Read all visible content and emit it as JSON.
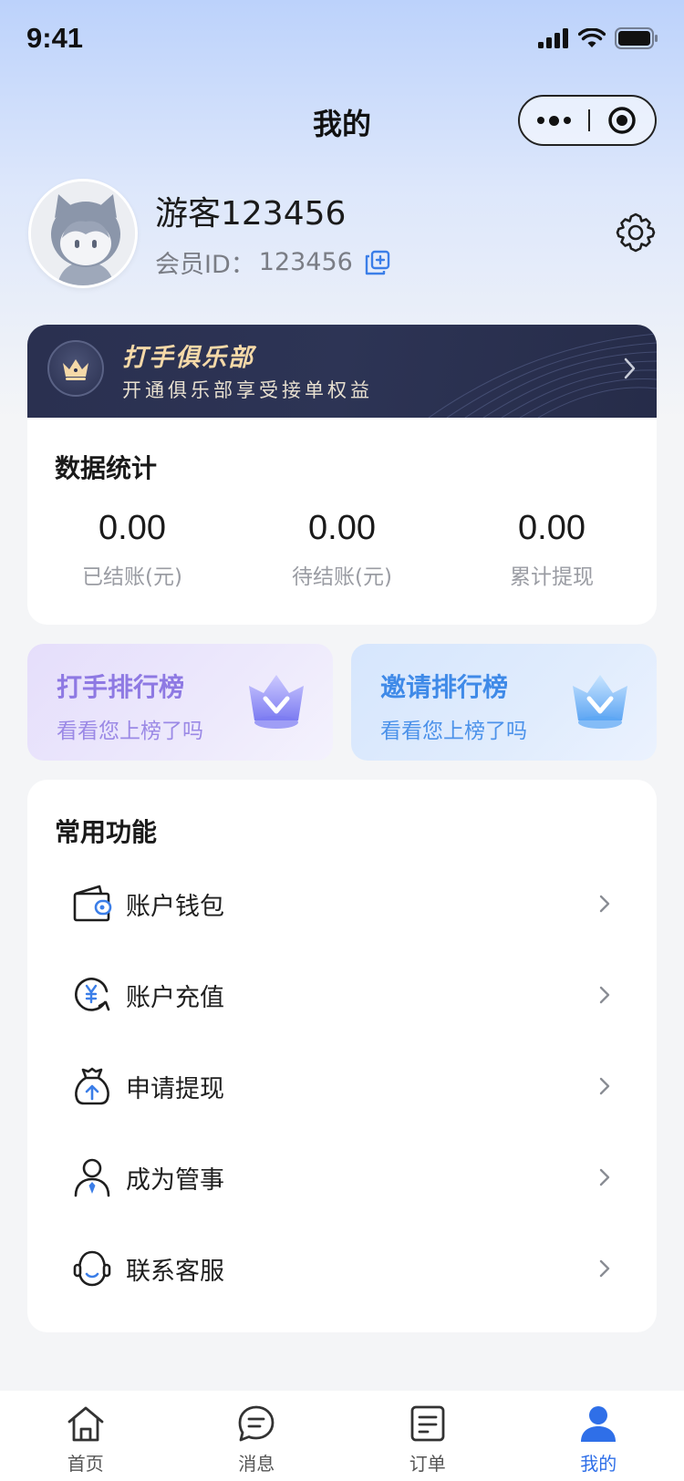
{
  "status_bar": {
    "time": "9:41"
  },
  "nav": {
    "title": "我的"
  },
  "profile": {
    "username": "游客123456",
    "member_id_label": "会员ID：",
    "member_id": "123456"
  },
  "club": {
    "title": "打手俱乐部",
    "subtitle": "开通俱乐部享受接单权益"
  },
  "stats": {
    "title": "数据统计",
    "items": [
      {
        "value": "0.00",
        "label": "已结账(元)"
      },
      {
        "value": "0.00",
        "label": "待结账(元)"
      },
      {
        "value": "0.00",
        "label": "累计提现"
      }
    ]
  },
  "rankings": [
    {
      "title": "打手排行榜",
      "subtitle": "看看您上榜了吗"
    },
    {
      "title": "邀请排行榜",
      "subtitle": "看看您上榜了吗"
    }
  ],
  "functions": {
    "title": "常用功能",
    "items": [
      {
        "label": "账户钱包",
        "icon": "wallet-icon"
      },
      {
        "label": "账户充值",
        "icon": "recharge-icon"
      },
      {
        "label": "申请提现",
        "icon": "withdraw-bag-icon"
      },
      {
        "label": "成为管事",
        "icon": "manager-icon"
      },
      {
        "label": "联系客服",
        "icon": "customer-service-icon"
      }
    ]
  },
  "tabbar": {
    "items": [
      {
        "label": "首页",
        "icon": "home-icon"
      },
      {
        "label": "消息",
        "icon": "message-icon"
      },
      {
        "label": "订单",
        "icon": "order-icon"
      },
      {
        "label": "我的",
        "icon": "user-icon",
        "active": true
      }
    ]
  },
  "colors": {
    "accent": "#2f6fe8",
    "club_gold": "#f5d9a8",
    "club_bg": "#2a3050",
    "rank_purple": "#8e79e3",
    "rank_blue": "#3f8ae8"
  }
}
